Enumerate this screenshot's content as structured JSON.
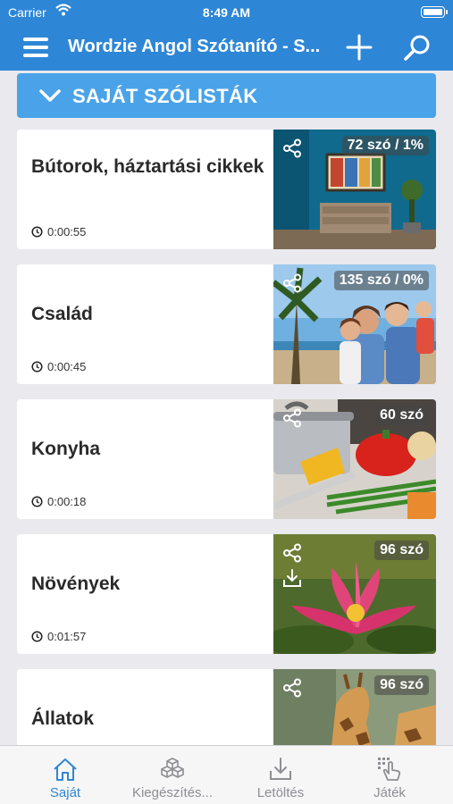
{
  "status_bar": {
    "carrier": "Carrier",
    "time": "8:49 AM"
  },
  "nav": {
    "title": "Wordzie Angol Szótanító - S...",
    "icons": [
      "menu-icon",
      "plus-icon",
      "search-icon"
    ]
  },
  "section": {
    "label": "SAJÁT SZÓLISTÁK",
    "icon": "chevron-down-icon"
  },
  "wordlists": [
    {
      "name": "Bútorok, háztartási cikkek",
      "time": "0:00:55",
      "count": "72 szó / 1%"
    },
    {
      "name": "Család",
      "time": "0:00:45",
      "count": "135 szó / 0%"
    },
    {
      "name": "Konyha",
      "time": "0:00:18",
      "count": "60 szó"
    },
    {
      "name": "Növények",
      "time": "0:01:57",
      "count": "96 szó"
    },
    {
      "name": "Állatok",
      "time": "",
      "count": "96 szó"
    }
  ],
  "tabs": [
    {
      "label": "Saját",
      "icon": "home-icon",
      "active": true
    },
    {
      "label": "Kiegészítés...",
      "icon": "cubes-icon",
      "active": false
    },
    {
      "label": "Letöltés",
      "icon": "download-icon",
      "active": false
    },
    {
      "label": "Játék",
      "icon": "touch-icon",
      "active": false
    }
  ],
  "colors": {
    "primary": "#2e86d6",
    "section_header": "#4aa3e8",
    "background": "#e9e9ee"
  }
}
